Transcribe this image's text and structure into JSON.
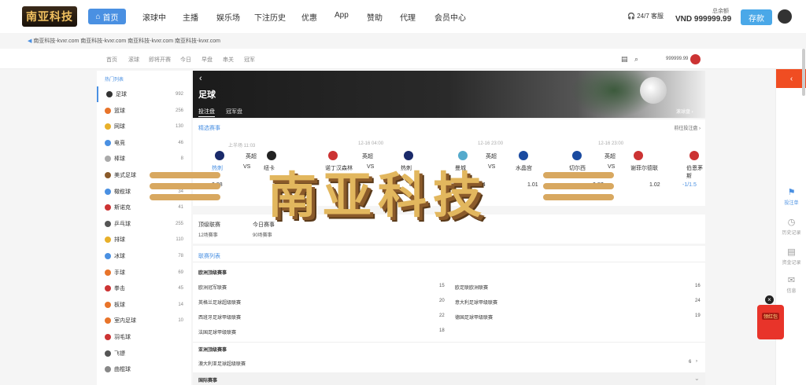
{
  "brand": {
    "logo_text": "南亚科技"
  },
  "topnav": {
    "home": "首页",
    "items": [
      "滚球中",
      "主播",
      "娱乐场",
      "下注历史",
      "优惠",
      "App",
      "赞助",
      "代理",
      "会员中心"
    ],
    "service": "24/7 客服",
    "balance_label": "总余额",
    "balance": "VND 999999.99",
    "deposit": "存款"
  },
  "marquee": "南亚科技-kvxr.com 南亚科技-kvxr.com 南亚科技-kvxr.com 南亚科技-kvxr.com",
  "subnav": {
    "items": [
      "首页",
      "滚球",
      "即将开赛",
      "今日",
      "早盘",
      "串关",
      "冠军"
    ],
    "balance": "999999.99"
  },
  "sidebar": {
    "title": "热门列表",
    "items": [
      {
        "label": "足球",
        "count": "992",
        "color": "#333"
      },
      {
        "label": "篮球",
        "count": "256",
        "color": "#e8742a"
      },
      {
        "label": "网球",
        "count": "130",
        "color": "#e8b02a"
      },
      {
        "label": "电竞",
        "count": "46",
        "color": "#4a90e2"
      },
      {
        "label": "棒球",
        "count": "8",
        "color": "#aaa"
      },
      {
        "label": "美式足球",
        "count": "63",
        "color": "#8a5a2a"
      },
      {
        "label": "橄榄球",
        "count": "34",
        "color": "#4a90e2"
      },
      {
        "label": "斯诺克",
        "count": "41",
        "color": "#c33"
      },
      {
        "label": "乒乓球",
        "count": "255",
        "color": "#555"
      },
      {
        "label": "排球",
        "count": "110",
        "color": "#e8b02a"
      },
      {
        "label": "冰球",
        "count": "78",
        "color": "#4a90e2"
      },
      {
        "label": "手球",
        "count": "69",
        "color": "#e8742a"
      },
      {
        "label": "拳击",
        "count": "45",
        "color": "#c33"
      },
      {
        "label": "板球",
        "count": "14",
        "color": "#e8742a"
      },
      {
        "label": "室内足球",
        "count": "10",
        "color": "#e8742a"
      },
      {
        "label": "羽毛球",
        "count": "",
        "color": "#c33"
      },
      {
        "label": "飞镖",
        "count": "",
        "color": "#555"
      },
      {
        "label": "曲棍球",
        "count": "",
        "color": "#888"
      }
    ]
  },
  "hero": {
    "back": "‹",
    "title": "足球",
    "tabs": [
      "投注盘",
      "冠军盘"
    ],
    "right": "滚球盘 ›"
  },
  "featured": {
    "title": "精选赛事",
    "more": "前往投注盘 ›",
    "times": [
      "上半场 11:03",
      "12-16 04:00",
      "12-16 23:00",
      "12-16 23:00"
    ],
    "leagues": [
      "英超",
      "英超",
      "英超",
      "英超"
    ],
    "teams": [
      {
        "name": "热刺",
        "blue": true
      },
      {
        "name": "纽卡",
        "blue": false
      },
      {
        "name": "诺丁汉森林",
        "blue": false
      },
      {
        "name": "热刺",
        "blue": false
      },
      {
        "name": "曼城",
        "blue": false
      },
      {
        "name": "水晶宫",
        "blue": false
      },
      {
        "name": "切尔西",
        "blue": false
      },
      {
        "name": "谢菲尔德联",
        "blue": false
      },
      {
        "name": "伯恩茅斯",
        "blue": false
      }
    ],
    "vs": [
      "VS",
      "VS",
      "VS",
      "VS"
    ],
    "odds": [
      "0.98",
      "0.92",
      "0.95",
      "0.94",
      "0.84",
      "1.01",
      "0.87",
      "1.02",
      "-1/1.5"
    ]
  },
  "sec2": {
    "items": [
      {
        "label": "顶级联赛",
        "sub": "12场赛事"
      },
      {
        "label": "今日赛事",
        "sub": "90场赛事"
      }
    ]
  },
  "leagues": {
    "title": "联赛列表",
    "group1": "欧洲顶级赛事",
    "left": [
      {
        "name": "欧洲冠军联赛",
        "count": "15"
      },
      {
        "name": "英格兰足球超级联赛",
        "count": "20"
      },
      {
        "name": "西班牙足球甲级联赛",
        "count": "22"
      },
      {
        "name": "法国足球甲级联赛",
        "count": "18"
      }
    ],
    "right": [
      {
        "name": "欧足联欧洲联赛",
        "count": "16"
      },
      {
        "name": "意大利足球甲级联赛",
        "count": "24"
      },
      {
        "name": "德国足球甲级联赛",
        "count": "19"
      }
    ],
    "group2": "亚洲顶级赛事",
    "asia": {
      "name": "澳大利亚足球超级联赛",
      "count": "6"
    },
    "intl": "国际赛事"
  },
  "watermark": "南亚科技",
  "rail": {
    "items": [
      "投注单",
      "历史记录",
      "资金记录",
      "信息"
    ],
    "redpack": "领红包"
  }
}
